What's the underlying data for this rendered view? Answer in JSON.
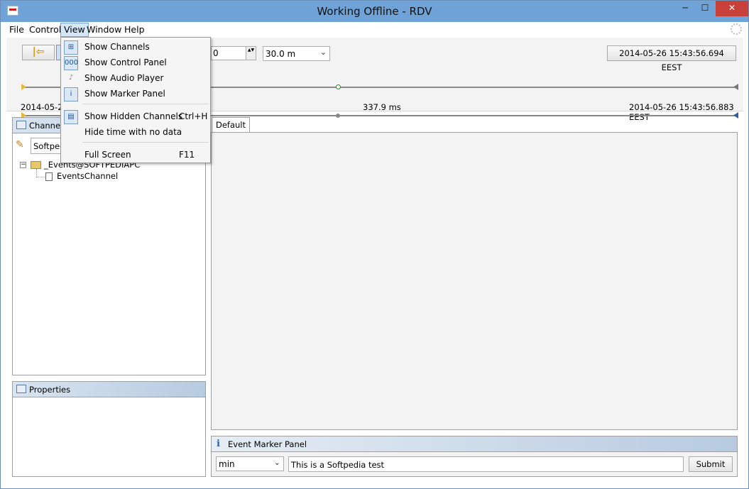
{
  "window": {
    "title": "Working Offline - RDV",
    "minimize_glyph": "─",
    "maximize_glyph": "☐",
    "close_glyph": "✕",
    "accent_color": "#6fa3d8"
  },
  "menubar": {
    "items": [
      "File",
      "Control",
      "View",
      "Window",
      "Help"
    ],
    "active": "View"
  },
  "view_menu": {
    "items": [
      {
        "label": "Show Channels",
        "shortcut": "",
        "icon": "channels-icon",
        "glyph": "⊞"
      },
      {
        "label": "Show Control Panel",
        "shortcut": "",
        "icon": "control-panel-icon",
        "glyph": "000"
      },
      {
        "label": "Show Audio Player",
        "shortcut": "",
        "icon": "audio-player-icon",
        "glyph": "♪"
      },
      {
        "label": "Show Marker Panel",
        "shortcut": "",
        "icon": "info-icon",
        "glyph": "i"
      },
      {
        "label": "Show Hidden Channels",
        "shortcut": "Ctrl+H",
        "icon": "hidden-channels-icon",
        "glyph": "▤"
      },
      {
        "label": "Hide time with no data",
        "shortcut": "",
        "icon": "",
        "glyph": ""
      },
      {
        "label": "Full Screen",
        "shortcut": "F11",
        "icon": "",
        "glyph": ""
      }
    ]
  },
  "toolbar": {
    "back_glyph": "|⇦",
    "spinner_value": "0",
    "spinner_arrows": "▲▼",
    "time_range": "30.0 m",
    "dropdown_glyph": "⌄",
    "current_time": "2014-05-26 15:43:56.694 EEST",
    "start_time": "2014-05-26",
    "duration": "337.9 ms",
    "end_time": "2014-05-26 15:43:56.883 EEST"
  },
  "channels_panel": {
    "title": "Channels",
    "filter_value": "Softped",
    "filter_glyph": "✎",
    "expander_glyph": "−",
    "tree": [
      {
        "label": "_Events@SOFTPEDIAPC",
        "type": "folder"
      },
      {
        "label": "EventsChannel",
        "type": "channel"
      }
    ]
  },
  "properties_panel": {
    "title": "Properties"
  },
  "content": {
    "tabs": [
      "Default"
    ]
  },
  "marker_panel": {
    "title": "Event Marker Panel",
    "info_glyph": "i",
    "unit": "min",
    "text": "This is a Softpedia test",
    "submit_label": "Submit"
  }
}
